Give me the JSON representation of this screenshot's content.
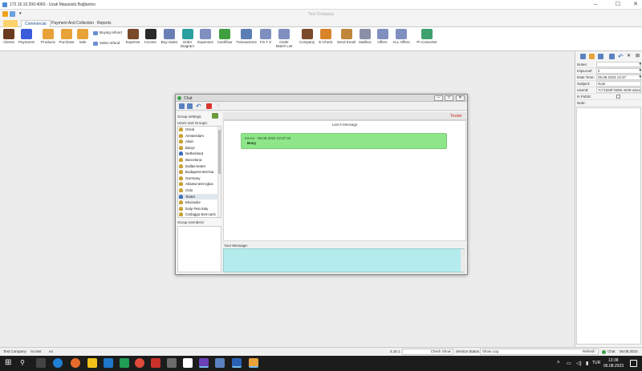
{
  "rdp": {
    "title": "172.15.10.200:4060 - Uzak Masaüstü Bağlantısı",
    "minimize": "–",
    "maximize": "☐",
    "close": "✕"
  },
  "app": {
    "title": "Test Company"
  },
  "tabs": [
    {
      "label": "Commercial",
      "active": true
    },
    {
      "label": "Payment And Collection",
      "active": false
    },
    {
      "label": "Reports",
      "active": false
    }
  ],
  "ribbon": {
    "buttons": [
      {
        "label": "Clients",
        "icon": "client-icon",
        "color": "#6b3b1f"
      },
      {
        "label": "Payments",
        "icon": "payments-icon",
        "color": "#3b5bdb"
      },
      {
        "label": "Products",
        "icon": "products-box-icon",
        "color": "#e8a23a"
      },
      {
        "label": "Purchase",
        "icon": "purchase-box-icon",
        "color": "#e8a23a"
      },
      {
        "label": "Sale",
        "icon": "sale-box-icon",
        "color": "#e8a23a"
      },
      {
        "label": "Expense",
        "icon": "expense-person-icon",
        "color": "#7a4a2a"
      },
      {
        "label": "Income",
        "icon": "income-person-icon",
        "color": "#2b2b2b"
      },
      {
        "label": "Buy-Sales",
        "icon": "buy-sales-icon",
        "color": "#6a7fb5"
      },
      {
        "label": "Order\nDiagram",
        "icon": "order-diagram-icon",
        "color": "#2aa0a0"
      },
      {
        "label": "Expenses",
        "icon": "expenses-list-icon",
        "color": "#7f8fc0"
      },
      {
        "label": "Cashflow",
        "icon": "cashflow-icon",
        "color": "#3f9f3f"
      },
      {
        "label": "Transactions",
        "icon": "transactions-icon",
        "color": "#5b7fb5"
      },
      {
        "label": "Fin T S",
        "icon": "fin-ts-icon",
        "color": "#7f8fc0"
      },
      {
        "label": "Order\nMatch List",
        "icon": "order-match-icon",
        "color": "#7f8fc0"
      },
      {
        "label": "Company",
        "icon": "company-person-icon",
        "color": "#7a4a2a"
      },
      {
        "label": "E-Check",
        "icon": "e-check-icon",
        "color": "#d9842b"
      },
      {
        "label": "Send Email",
        "icon": "send-email-icon",
        "color": "#c0863b"
      },
      {
        "label": "Mailbox",
        "icon": "mailbox-icon",
        "color": "#8a8fa8"
      },
      {
        "label": "Offers",
        "icon": "offers-icon",
        "color": "#7f8fc0"
      },
      {
        "label": "ALL Offers",
        "icon": "all-offers-icon",
        "color": "#7f8fc0"
      },
      {
        "label": "PI Converter",
        "icon": "pi-converter-icon",
        "color": "#3fa06f"
      }
    ],
    "small": [
      {
        "label": "Buying refund",
        "icon": "buying-refund-icon"
      },
      {
        "label": "Sales refund",
        "icon": "sales-refund-icon"
      }
    ]
  },
  "chat": {
    "title": "Chat",
    "group_settings": "Group settings:",
    "users_groups": "Users and Groups:",
    "users": [
      {
        "name": "Oreal",
        "color": "#caa135"
      },
      {
        "name": "Amsterdam",
        "color": "#caa135"
      },
      {
        "name": "Alain",
        "color": "#caa135"
      },
      {
        "name": "Barçe",
        "color": "#caa135"
      },
      {
        "name": "Netherland",
        "color": "#3b6fb5"
      },
      {
        "name": "Barcelona",
        "color": "#caa135"
      },
      {
        "name": "Dallas-tester",
        "color": "#caa135"
      },
      {
        "name": "Budapest-test-bur",
        "color": "#caa135"
      },
      {
        "name": "Germany",
        "color": "#caa135"
      },
      {
        "name": "Atlanta-test-vglus",
        "color": "#caa135"
      },
      {
        "name": "Oslo",
        "color": "#caa135"
      },
      {
        "name": "Tester",
        "color": "#3b6fb5",
        "selected": true
      },
      {
        "name": "Ekvirador",
        "color": "#caa135"
      },
      {
        "name": "Daly-Test Italy",
        "color": "#caa135"
      },
      {
        "name": "Carlaggo-test-carlc",
        "color": "#caa135"
      }
    ],
    "group_members": "Group members:",
    "partner": "Tester",
    "last_messages": "Last 5 Message",
    "message": {
      "meta": "Ka-no - 06.08.2023 13:37:34",
      "body": "Busy"
    },
    "your_message": "Your Message:",
    "input_value": ""
  },
  "right_panel": {
    "rows": [
      {
        "label": "Notes:",
        "value": ""
      },
      {
        "label": "ImpLevel:",
        "value": "0"
      },
      {
        "label": "Date Time:",
        "value": "06.08.2023 13:37"
      },
      {
        "label": "Subject:",
        "value": "Note"
      },
      {
        "label": "UserId:",
        "value": "7c71b60f-0595-4638-a0a4"
      },
      {
        "label": "Is Public:",
        "value": ""
      },
      {
        "label": "Note:",
        "value": ""
      }
    ]
  },
  "status": {
    "company": "Test Company",
    "user": "no test",
    "lang": "no",
    "version": "4.15.1",
    "check_show": "Check Show",
    "service_status_label": "Service Status",
    "service_status": "Show Log",
    "refresh": "Refresh",
    "chat": "Chat",
    "date": "06.08.2023"
  },
  "taskbar": {
    "time": "13:38",
    "date": "06.08.2023",
    "lang": "TUR"
  }
}
